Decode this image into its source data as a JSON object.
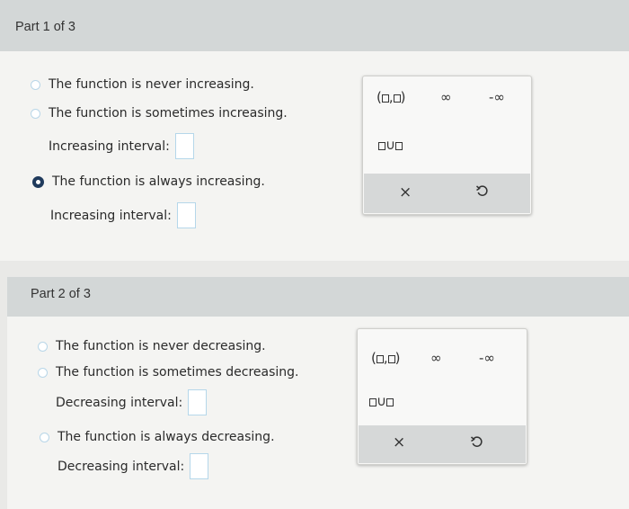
{
  "part1": {
    "header": "Part 1 of 3",
    "options": [
      "The function is never increasing.",
      "The function is sometimes increasing.",
      "The function is always increasing."
    ],
    "interval_label": "Increasing interval:",
    "selected_option": 2
  },
  "part2": {
    "header": "Part 2 of 3",
    "options": [
      "The function is never decreasing.",
      "The function is sometimes decreasing.",
      "The function is always decreasing."
    ],
    "interval_label": "Decreasing interval:",
    "selected_option": null
  },
  "palette": {
    "infinity": "∞",
    "neg_infinity": "-∞",
    "clear": "×",
    "undo_icon": "undo-icon"
  },
  "colors": {
    "header_bg": "#d3d7d7",
    "body_bg": "#f4f4f2",
    "radio_selected": "#1f3a5c",
    "input_border": "#b5d7ea"
  }
}
